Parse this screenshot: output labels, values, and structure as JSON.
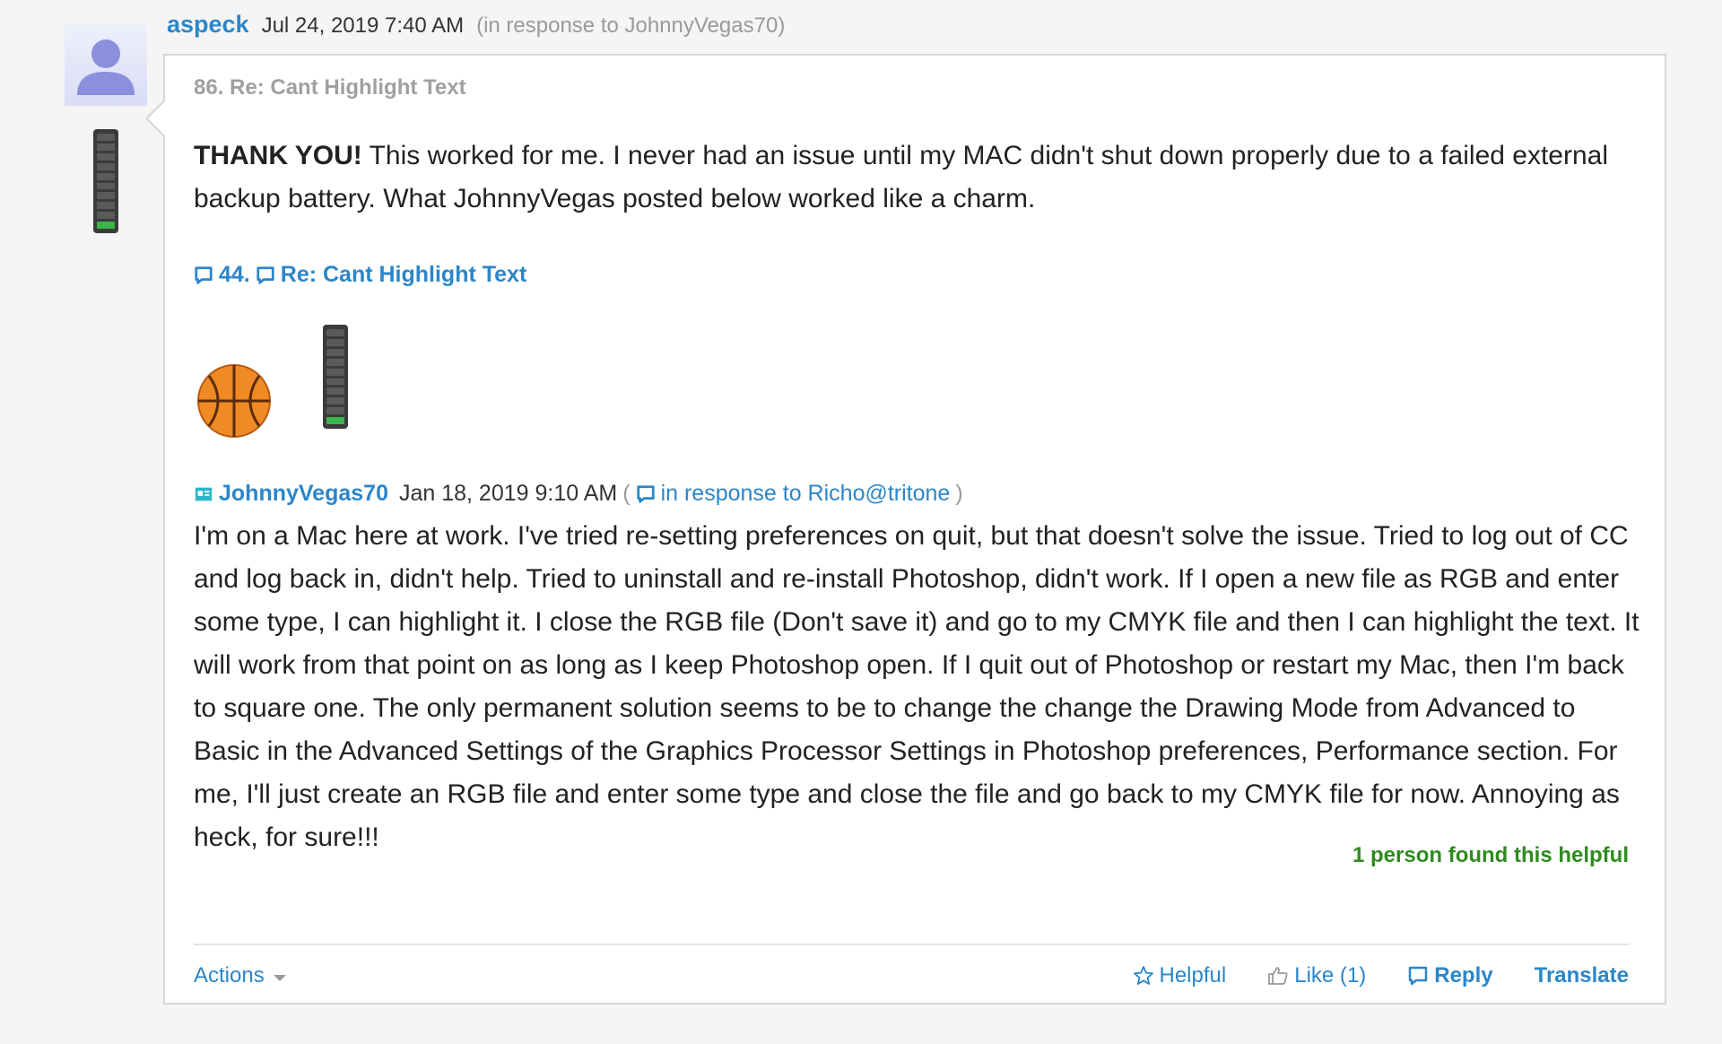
{
  "header": {
    "author": "aspeck",
    "date": "Jul 24, 2019 7:40 AM",
    "in_response": "(in response to JohnnyVegas70)"
  },
  "post": {
    "title": "86. Re: Cant Highlight Text",
    "body_bold": "THANK YOU!",
    "body_rest": " This worked for me. I never had an issue until my MAC didn't shut down properly due to a failed external backup battery. What JohnnyVegas posted below worked like a charm."
  },
  "quote": {
    "number": "44.",
    "title": "Re: Cant Highlight Text",
    "author": "JohnnyVegas70",
    "date": "Jan 18, 2019 9:10 AM",
    "paren_open": "(",
    "in_response": "in response to Richo@tritone",
    "paren_close": ")",
    "text": "I'm on a Mac here at work. I've tried re-setting preferences on quit, but that doesn't solve the issue. Tried to log out of CC and log back in, didn't help. Tried to uninstall and re-install Photoshop, didn't work. If I open a new file as RGB and enter some type, I can highlight it. I close the RGB file (Don't save it) and go to my CMYK file and then I can highlight the text. It will work from that point on as long as I keep Photoshop open. If I quit out of Photoshop or restart my Mac, then I'm back to square one. The only permanent solution seems to be to change the change the Drawing Mode from Advanced to Basic in the Advanced Settings of the Graphics Processor Settings in Photoshop preferences, Performance section. For me, I'll just create an RGB file and enter some type and close the file and go back to my CMYK file for now. Annoying as heck, for sure!!!"
  },
  "helpful_count": "1 person found this helpful",
  "actions": {
    "menu": "Actions",
    "helpful": "Helpful",
    "like": "Like (1)",
    "reply": "Reply",
    "translate": "Translate"
  },
  "colors": {
    "link": "#2b86c9",
    "helpful_green": "#2e8b1f",
    "rank_on": "#39b54a"
  }
}
